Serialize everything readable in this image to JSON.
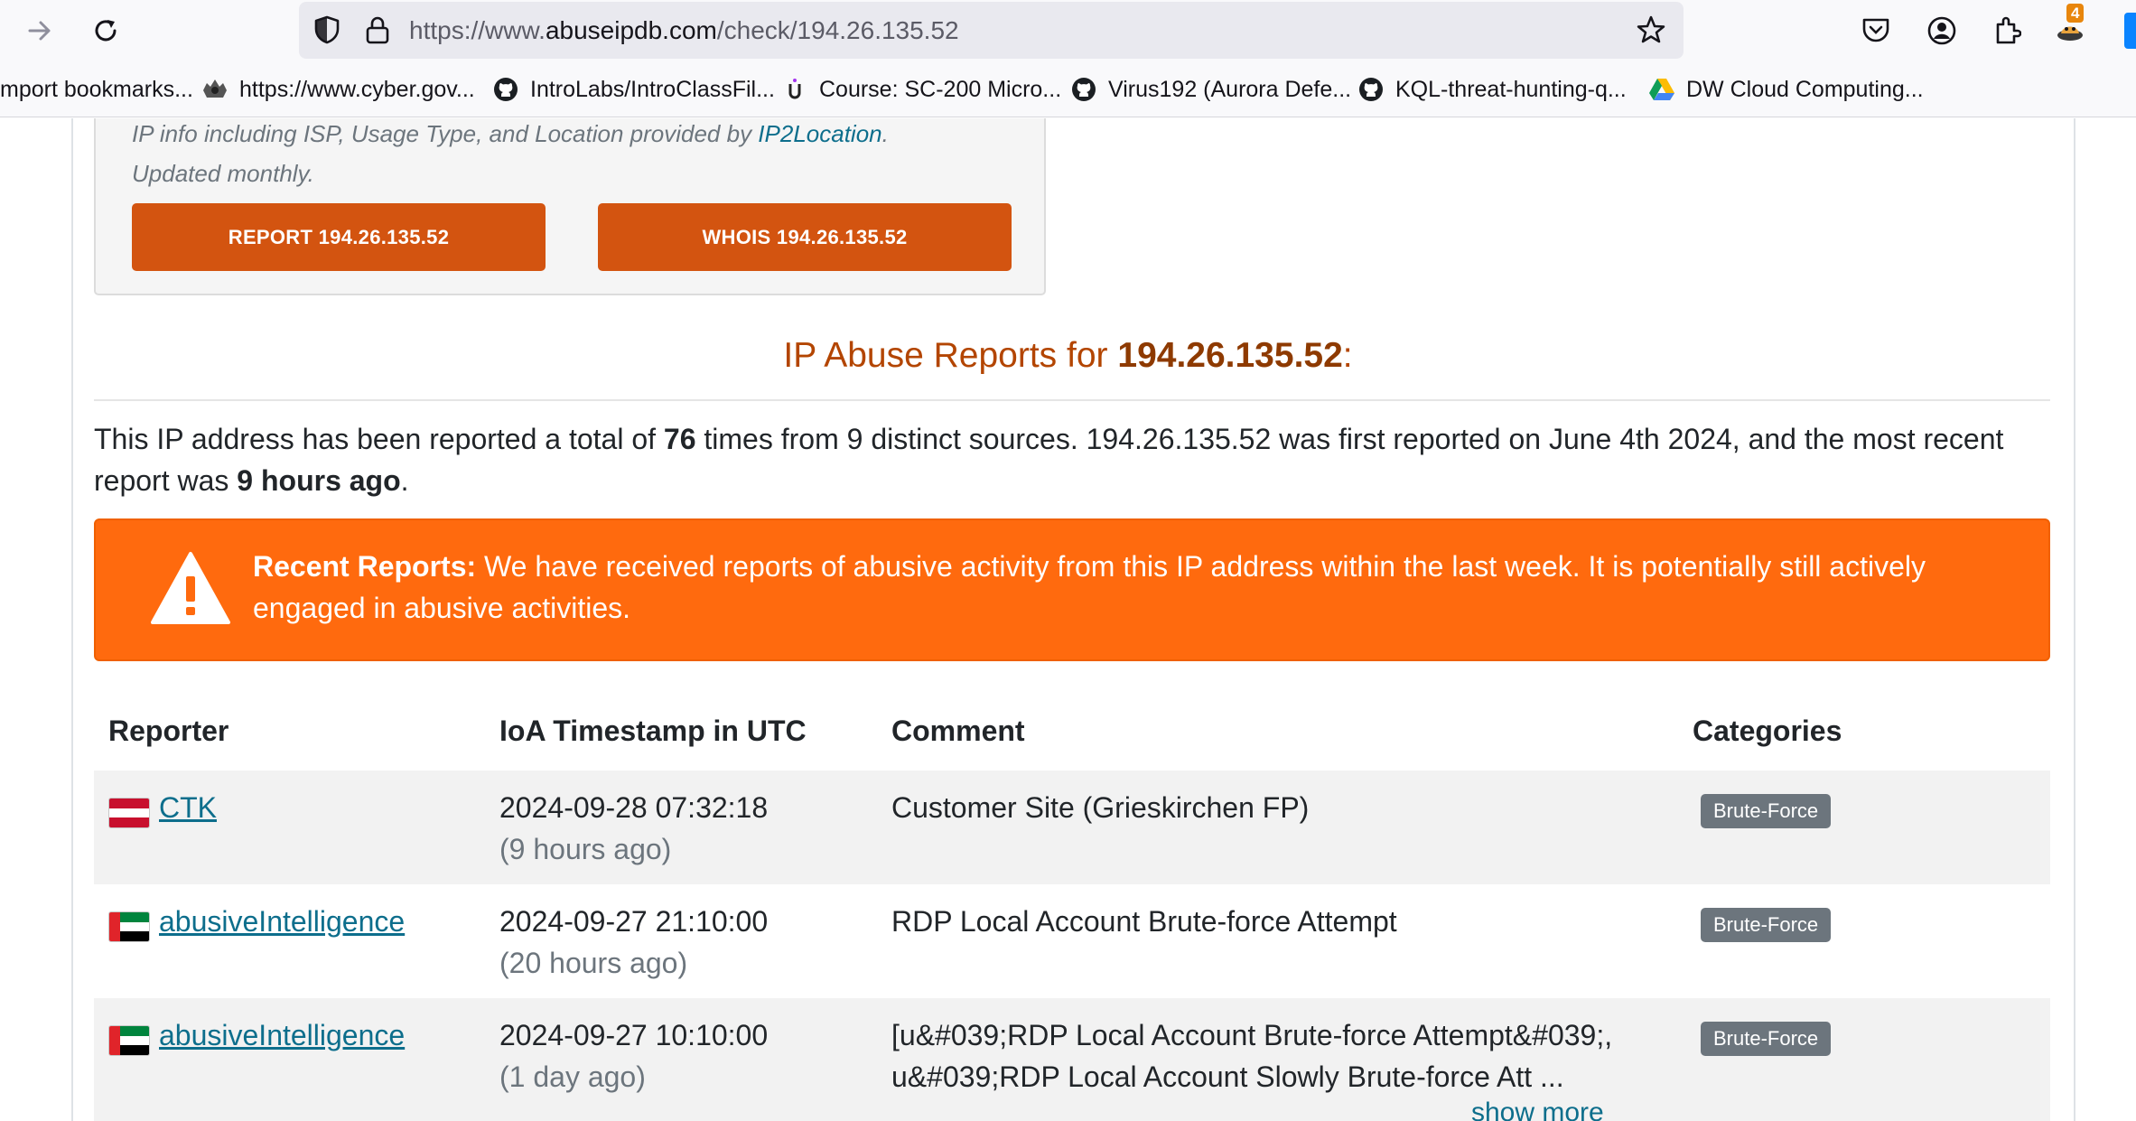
{
  "browser": {
    "url_prefix": "https://www.",
    "url_host": "abuseipdb.com",
    "url_path": "/check/194.26.135.52",
    "extension_badge": "4",
    "icons": [
      "forward-arrow-icon",
      "reload-icon",
      "shield-icon",
      "lock-icon",
      "bookmark-star-icon",
      "pocket-icon",
      "account-icon",
      "extensions-icon",
      "extension-icon"
    ]
  },
  "bookmarks": [
    {
      "label": "mport bookmarks...",
      "icon": "none"
    },
    {
      "label": "https://www.cyber.gov...",
      "icon": "crest-icon"
    },
    {
      "label": "IntroLabs/IntroClassFil...",
      "icon": "github-icon"
    },
    {
      "label": "Course: SC-200 Micro...",
      "icon": "course-icon"
    },
    {
      "label": "Virus192 (Aurora Defe...",
      "icon": "github-icon"
    },
    {
      "label": "KQL-threat-hunting-q...",
      "icon": "github-icon"
    },
    {
      "label": "DW Cloud Computing...",
      "icon": "google-drive-icon"
    }
  ],
  "info_card": {
    "faded_text": "IP info including ISP, Usage Type, and Location provided by ",
    "faded_link": "IP2Location",
    "faded_end": ".",
    "updated": "Updated monthly.",
    "report_button": "REPORT 194.26.135.52",
    "whois_button": "WHOIS 194.26.135.52"
  },
  "heading": {
    "prefix": "IP Abuse Reports for ",
    "ip": "194.26.135.52",
    "suffix": ":"
  },
  "summary": {
    "p1": "This IP address has been reported a total of ",
    "count": "76",
    "p2": " times from 9 distinct sources. 194.26.135.52 was first reported on June 4th 2024, and the most recent report was ",
    "recent": "9 hours ago",
    "p3": "."
  },
  "alert": {
    "title": "Recent Reports:",
    "text": " We have received reports of abusive activity from this IP address within the last week. It is potentially still actively engaged in abusive activities.",
    "color": "#ff6a0e"
  },
  "table": {
    "headers": [
      "Reporter",
      "IoA Timestamp in UTC",
      "Comment",
      "Categories"
    ],
    "rows": [
      {
        "flag": "austria",
        "reporter": "CTK",
        "timestamp": "2024-09-28 07:32:18",
        "ago": "(9 hours ago)",
        "comment": "Customer Site (Grieskirchen FP)",
        "category": "Brute-Force"
      },
      {
        "flag": "uae",
        "reporter": "abusiveIntelligence",
        "timestamp": "2024-09-27 21:10:00",
        "ago": "(20 hours ago)",
        "comment": "RDP Local Account Brute-force Attempt",
        "category": "Brute-Force"
      },
      {
        "flag": "uae",
        "reporter": "abusiveIntelligence",
        "timestamp": "2024-09-27 10:10:00",
        "ago": "(1 day ago)",
        "comment": "[u&#039;RDP Local Account Brute-force Attempt&#039;, u&#039;RDP Local Account Slowly Brute-force Att ...",
        "category": "Brute-Force"
      }
    ],
    "show_more": "show more"
  },
  "colors": {
    "accent_orange": "#d35410",
    "heading": "#b34500",
    "link": "#0d6e8c",
    "badge": "#6c757d"
  }
}
